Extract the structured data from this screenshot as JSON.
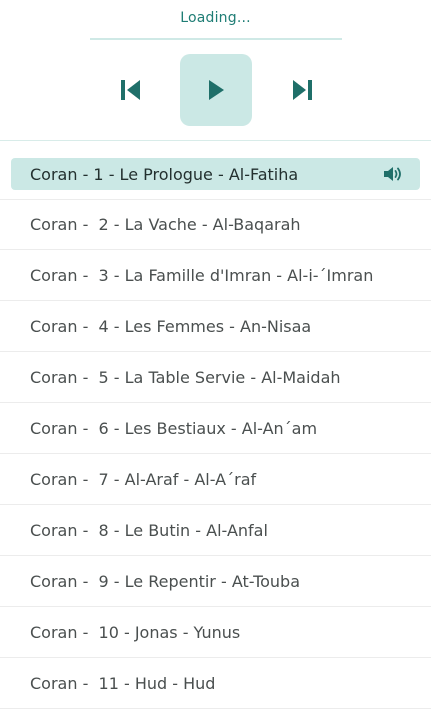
{
  "player": {
    "status": "Loading...",
    "progress": 0,
    "controls": [
      "previous-icon",
      "play-icon",
      "next-icon"
    ]
  },
  "colors": {
    "accent": "#1f6f69",
    "active_bg": "#cbe8e5",
    "status_text": "#1f7d75"
  },
  "tracks": [
    {
      "label": "Coran - 1 - Le Prologue - Al-Fatiha",
      "active": true
    },
    {
      "label": "Coran -  2 - La Vache - Al-Baqarah"
    },
    {
      "label": "Coran -  3 - La Famille d'Imran - Al-i-´Imran"
    },
    {
      "label": "Coran -  4 - Les Femmes - An-Nisaa"
    },
    {
      "label": "Coran -  5 - La Table Servie - Al-Maidah"
    },
    {
      "label": "Coran -  6 - Les Bestiaux - Al-An´am"
    },
    {
      "label": "Coran -  7 - Al-Araf - Al-A´raf"
    },
    {
      "label": "Coran -  8 - Le Butin - Al-Anfal"
    },
    {
      "label": "Coran -  9 - Le Repentir - At-Touba"
    },
    {
      "label": "Coran -  10 - Jonas - Yunus"
    },
    {
      "label": "Coran -  11 - Hud - Hud"
    }
  ]
}
